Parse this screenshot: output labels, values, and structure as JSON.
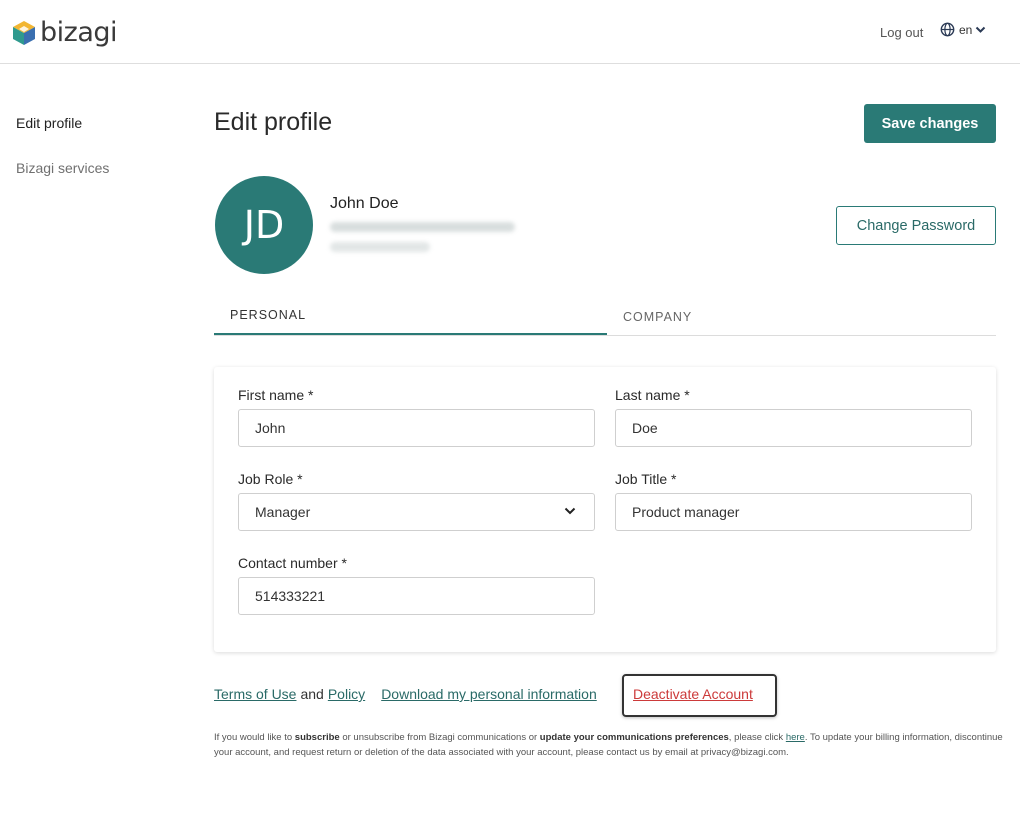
{
  "header": {
    "brand": "bizagi",
    "logout_label": "Log out",
    "language": "en"
  },
  "sidebar": {
    "items": [
      {
        "label": "Edit profile",
        "active": true
      },
      {
        "label": "Bizagi services",
        "active": false
      }
    ]
  },
  "main": {
    "title": "Edit profile",
    "save_label": "Save changes",
    "change_password_label": "Change Password",
    "user": {
      "initials": "JD",
      "name": "John Doe"
    },
    "tabs": [
      {
        "label": "PERSONAL",
        "active": true
      },
      {
        "label": "COMPANY",
        "active": false
      }
    ],
    "form": {
      "first_name": {
        "label": "First name *",
        "value": "John"
      },
      "last_name": {
        "label": "Last name *",
        "value": "Doe"
      },
      "job_role": {
        "label": "Job Role *",
        "value": "Manager"
      },
      "job_title": {
        "label": "Job Title *",
        "value": "Product manager"
      },
      "contact_number": {
        "label": "Contact number *",
        "value": "514333221"
      }
    }
  },
  "footer": {
    "terms_label": "Terms of Use",
    "and_text": "and",
    "policy_label": "Policy",
    "download_label": "Download my personal information",
    "deactivate_label": "Deactivate Account",
    "fine_print": {
      "p1": "If you would like to ",
      "b1": "subscribe",
      "p2": " or unsubscribe from Bizagi communications or ",
      "b2": "update your communications preferences",
      "p3": ", please click ",
      "here": "here",
      "p4": ". To update your billing information, discontinue your account, and request return or deletion of the data associated with your account, please contact us by email at privacy@bizagi.com."
    }
  },
  "colors": {
    "accent": "#2a7a76",
    "danger": "#cc3a3a"
  }
}
